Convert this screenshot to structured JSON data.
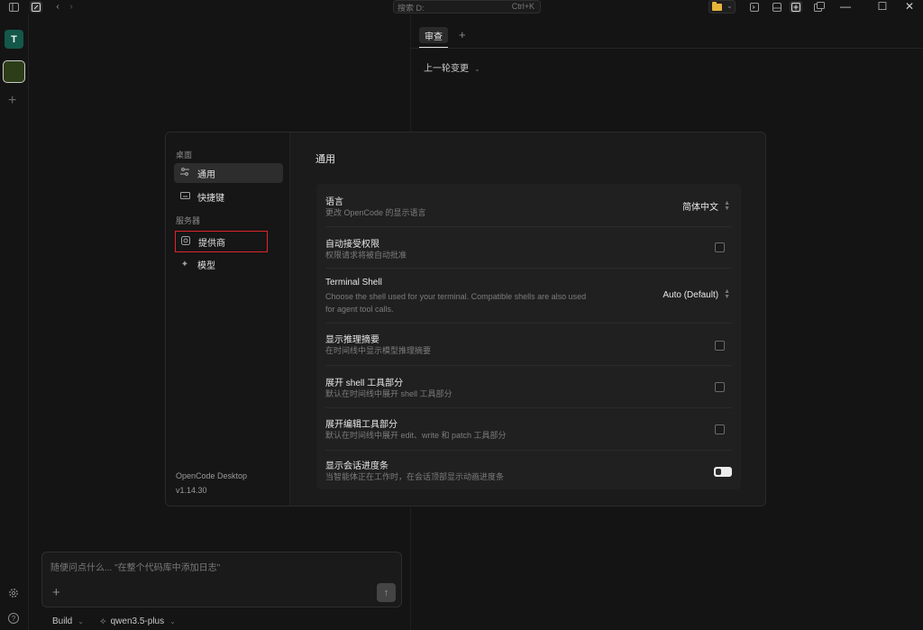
{
  "titlebar": {
    "search_placeholder": "搜索 D:",
    "search_shortcut": "Ctrl+K",
    "icons": [
      "sidebar-toggle-icon",
      "new-session-icon",
      "back-icon",
      "forward-icon",
      "folder-icon",
      "terminal-icon",
      "review-panel-icon",
      "popout-icon"
    ]
  },
  "window": {
    "minimize": "—",
    "maximize": "☐",
    "close": "✕"
  },
  "rail": {
    "workspace_initial": "T",
    "add_label": "+",
    "workspace_colors": [
      "#14584a",
      "#2d3d18"
    ]
  },
  "tabs": {
    "review_label": "审查",
    "add_label": "+",
    "last_change_label": "上一轮变更"
  },
  "settings": {
    "sections": {
      "desktop": "桌面",
      "server": "服务器"
    },
    "nav": {
      "general": "通用",
      "shortcuts": "快捷键",
      "providers": "提供商",
      "models": "模型"
    },
    "footer": {
      "app_name": "OpenCode Desktop",
      "version": "v1.14.30"
    },
    "title": "通用",
    "rows": {
      "language": {
        "title": "语言",
        "desc": "更改 OpenCode 的显示语言",
        "value": "简体中文"
      },
      "auto_accept": {
        "title": "自动接受权限",
        "desc": "权限请求将被自动批准",
        "checked": false
      },
      "terminal_shell": {
        "title": "Terminal Shell",
        "desc1": "Choose the shell used for your terminal. Compatible shells are also used",
        "desc2": "for agent tool calls.",
        "value": "Auto (Default)"
      },
      "reasoning": {
        "title": "显示推理摘要",
        "desc": "在时间线中显示模型推理摘要",
        "checked": false
      },
      "shell_parts": {
        "title": "展开 shell 工具部分",
        "desc": "默认在时间线中展开 shell 工具部分",
        "checked": false
      },
      "edit_parts": {
        "title": "展开编辑工具部分",
        "desc": "默认在时间线中展开 edit、write 和 patch 工具部分",
        "checked": false
      },
      "progress": {
        "title": "显示会话进度条",
        "desc": "当智能体正在工作时，在会话顶部显示动画进度条",
        "enabled": true
      }
    }
  },
  "composer": {
    "placeholder": "随便问点什么... \"在整个代码库中添加日志\"",
    "add_label": "+",
    "send_label": "↑",
    "agent": "Build",
    "model": "qwen3.5-plus"
  },
  "colors": {
    "highlight_box": "#e0252b",
    "folder": "#e8b53a"
  }
}
